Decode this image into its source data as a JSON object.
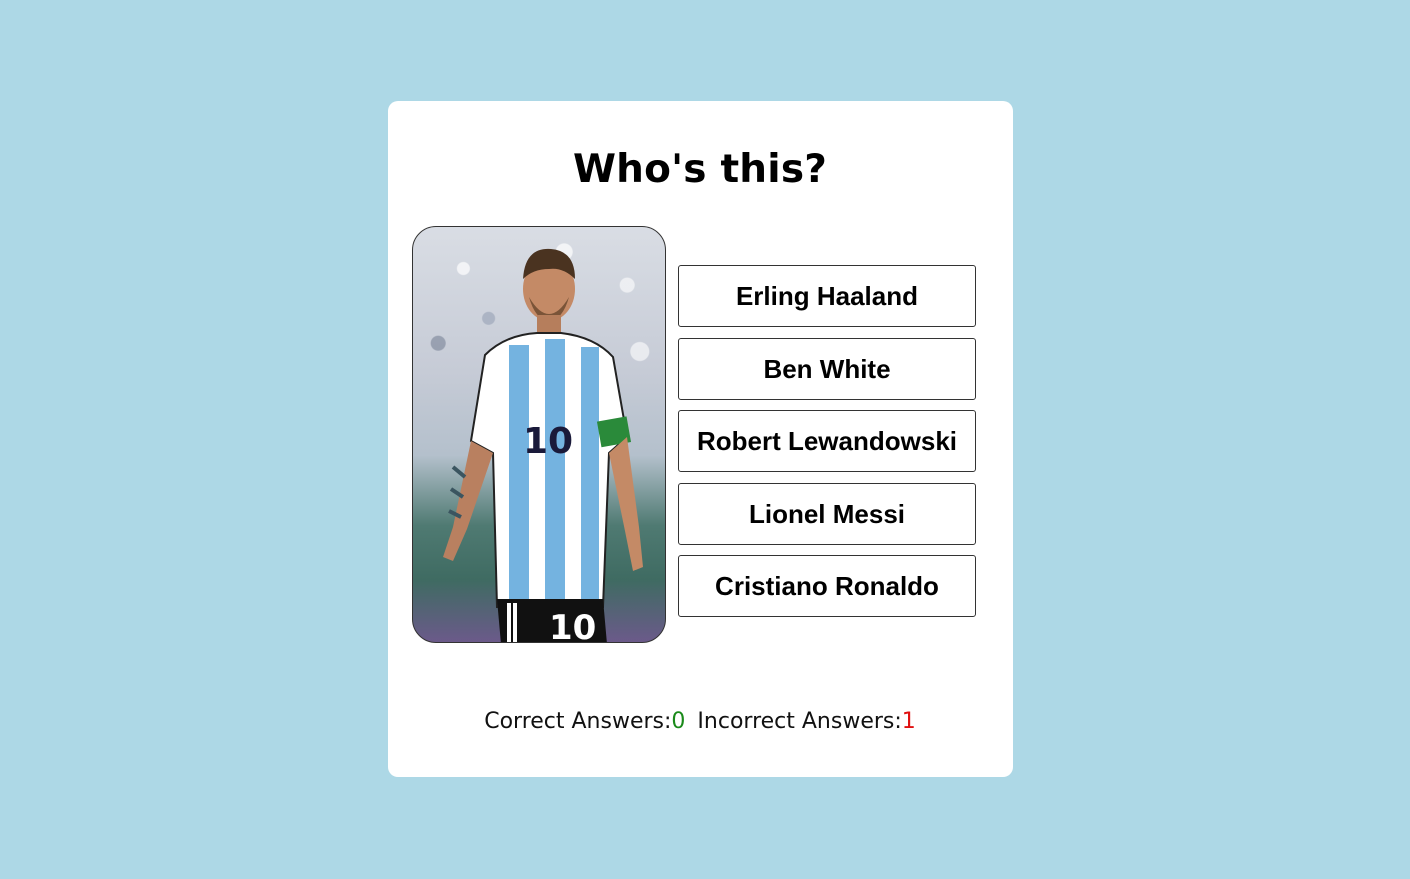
{
  "quiz": {
    "title": "Who's this?",
    "image_alt": "Football player in a light blue and white striped number 10 jersey",
    "options": [
      {
        "label": "Erling Haaland"
      },
      {
        "label": "Ben White"
      },
      {
        "label": "Robert Lewandowski"
      },
      {
        "label": "Lionel Messi"
      },
      {
        "label": "Cristiano Ronaldo"
      }
    ]
  },
  "score": {
    "correct_label": "Correct Answers:",
    "correct_value": "0",
    "incorrect_label": "Incorrect Answers:",
    "incorrect_value": "1"
  },
  "colors": {
    "background": "#add8e6",
    "card": "#ffffff",
    "correct": "#1a8a1a",
    "incorrect": "#e01010"
  }
}
